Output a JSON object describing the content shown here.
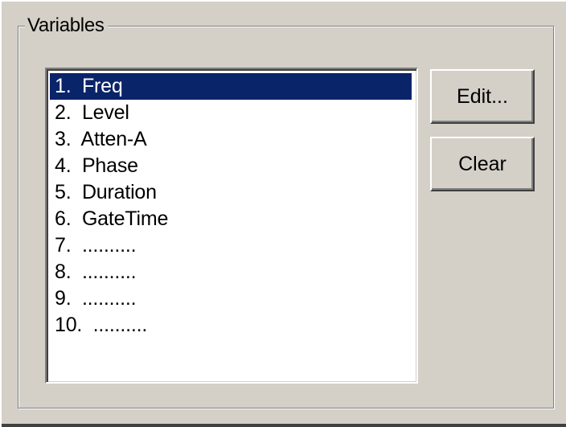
{
  "variables_group": {
    "title": "Variables",
    "items": [
      {
        "label": "1.  Freq",
        "selected": true
      },
      {
        "label": "2.  Level",
        "selected": false
      },
      {
        "label": "3.  Atten-A",
        "selected": false
      },
      {
        "label": "4.  Phase",
        "selected": false
      },
      {
        "label": "5.  Duration",
        "selected": false
      },
      {
        "label": "6.  GateTime",
        "selected": false
      },
      {
        "label": "7.  ..........",
        "selected": false
      },
      {
        "label": "8.  ..........",
        "selected": false
      },
      {
        "label": "9.  ..........",
        "selected": false
      },
      {
        "label": "10.  ..........",
        "selected": false
      }
    ]
  },
  "buttons": {
    "edit_label": "Edit...",
    "clear_label": "Clear"
  },
  "colors": {
    "dialog_background": "#d4d0c8",
    "selection_background": "#0a246a",
    "selection_text": "#ffffff"
  }
}
